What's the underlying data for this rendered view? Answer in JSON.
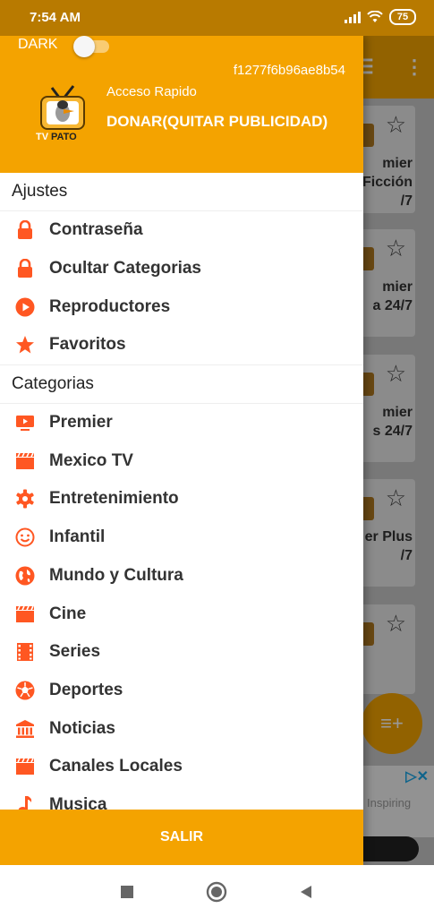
{
  "status_bar": {
    "time": "7:54 AM",
    "battery": "75"
  },
  "header": {
    "dark_label": "DARK",
    "dark_mode_on": false,
    "device_id": "f1277f6b96ae8b54",
    "quick_access": "Acceso Rapido",
    "donate": "DONAR(QUITAR PUBLICIDAD)",
    "logo_text": "PATO"
  },
  "menu": {
    "settings_title": "Ajustes",
    "settings_items": [
      {
        "label": "Contraseña",
        "icon": "lock-icon"
      },
      {
        "label": "Ocultar Categorias",
        "icon": "lock-icon"
      },
      {
        "label": "Reproductores",
        "icon": "play-circle-icon"
      },
      {
        "label": "Favoritos",
        "icon": "star-icon"
      }
    ],
    "categories_title": "Categorias",
    "category_items": [
      {
        "label": "Premier",
        "icon": "tv-play-icon"
      },
      {
        "label": "Mexico TV",
        "icon": "clapperboard-icon"
      },
      {
        "label": "Entretenimiento",
        "icon": "gear-icon"
      },
      {
        "label": "Infantil",
        "icon": "smiley-icon"
      },
      {
        "label": "Mundo y Cultura",
        "icon": "globe-icon"
      },
      {
        "label": "Cine",
        "icon": "clapperboard-icon"
      },
      {
        "label": "Series",
        "icon": "film-strip-icon"
      },
      {
        "label": "Deportes",
        "icon": "soccer-ball-icon"
      },
      {
        "label": "Noticias",
        "icon": "bank-icon"
      },
      {
        "label": "Canales Locales",
        "icon": "clapperboard-icon"
      },
      {
        "label": "Musica",
        "icon": "music-note-icon"
      }
    ]
  },
  "footer": {
    "exit_label": "SALIR"
  },
  "background": {
    "cards": [
      "mier\nFicción\n/7",
      "mier\na 24/7",
      "mier\ns 24/7",
      "er Plus\n/7",
      ""
    ],
    "ad_text": "Inspiring"
  },
  "colors": {
    "accent": "#f4a300",
    "icon": "#ff5722",
    "status_bar": "#b87a00"
  }
}
